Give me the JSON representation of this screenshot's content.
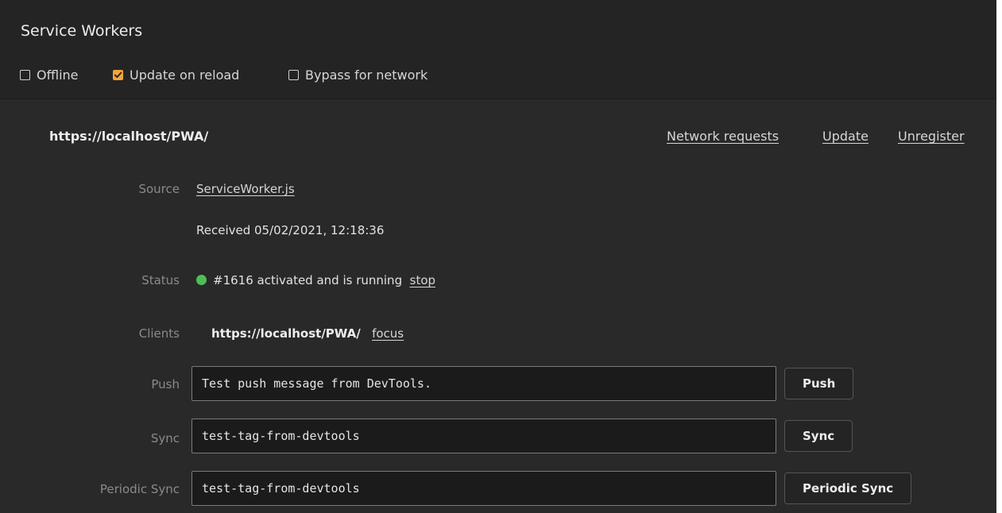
{
  "header": {
    "title": "Service Workers",
    "options": [
      {
        "label": "Offline",
        "checked": false
      },
      {
        "label": "Update on reload",
        "checked": true
      },
      {
        "label": "Bypass for network",
        "checked": false
      }
    ]
  },
  "worker": {
    "scope_url": "https://localhost/PWA/",
    "actions": {
      "network_requests": "Network requests",
      "update": "Update",
      "unregister": "Unregister"
    },
    "source": {
      "label": "Source",
      "file": "ServiceWorker.js",
      "received": "Received 05/02/2021, 12:18:36"
    },
    "status": {
      "label": "Status",
      "text": "#1616 activated and is running",
      "stop_label": "stop",
      "dot_color": "#4cbf53"
    },
    "clients": {
      "label": "Clients",
      "url": "https://localhost/PWA/",
      "focus_label": "focus"
    },
    "push": {
      "label": "Push",
      "value": "Test push message from DevTools.",
      "button": "Push"
    },
    "sync": {
      "label": "Sync",
      "value": "test-tag-from-devtools",
      "button": "Sync"
    },
    "periodic_sync": {
      "label": "Periodic Sync",
      "value": "test-tag-from-devtools",
      "button": "Periodic Sync"
    }
  },
  "colors": {
    "accent_checkbox": "#f2a43c",
    "panel_bg": "#242424",
    "content_bg": "#292929"
  }
}
